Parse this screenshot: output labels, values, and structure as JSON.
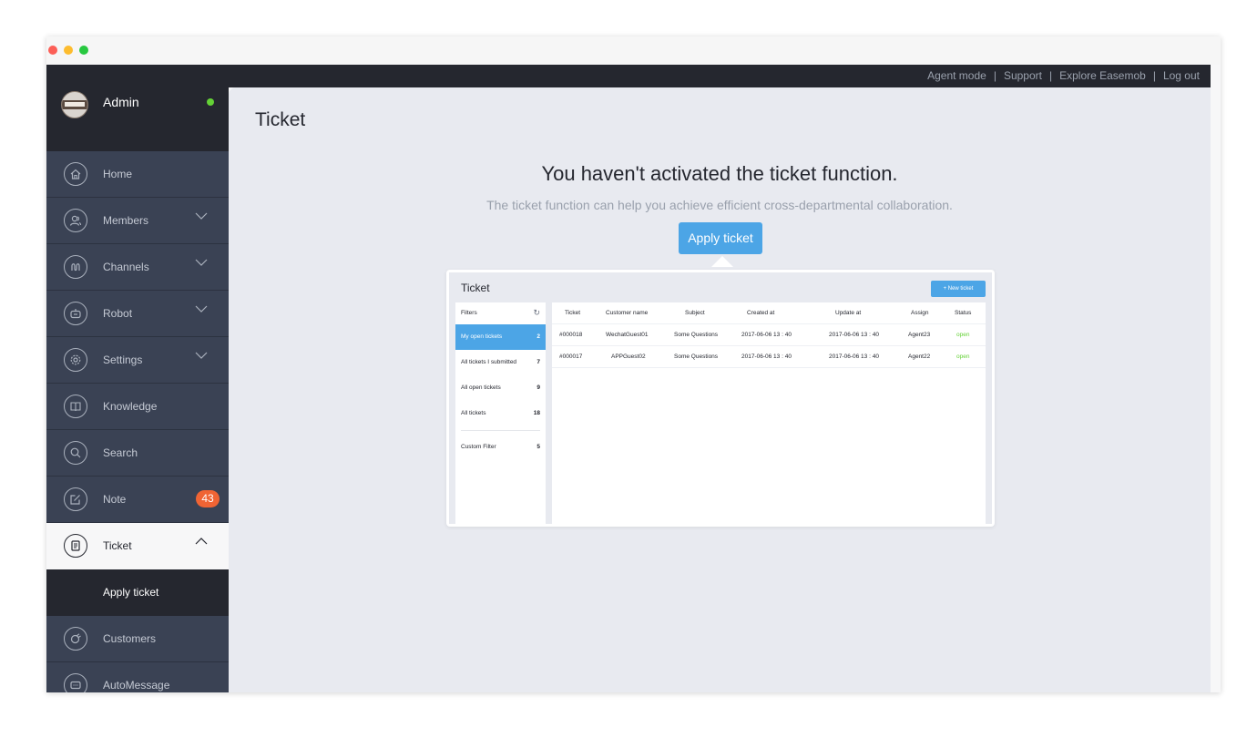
{
  "topbar": {
    "links": [
      "Agent mode",
      "Support",
      "Explore Easemob",
      "Log out"
    ],
    "separator": "|"
  },
  "profile": {
    "name": "Admin",
    "status_color": "#64d136"
  },
  "sidebar": {
    "items": [
      {
        "label": "Home",
        "icon": "home-icon"
      },
      {
        "label": "Members",
        "icon": "members-icon"
      },
      {
        "label": "Channels",
        "icon": "channels-icon"
      },
      {
        "label": "Robot",
        "icon": "robot-icon"
      },
      {
        "label": "Settings",
        "icon": "settings-icon"
      },
      {
        "label": "Knowledge",
        "icon": "knowledge-icon"
      },
      {
        "label": "Search",
        "icon": "search-icon"
      },
      {
        "label": "Note",
        "icon": "note-icon",
        "badge": "43"
      },
      {
        "label": "Ticket",
        "icon": "ticket-icon"
      },
      {
        "label": "Apply ticket"
      },
      {
        "label": "Customers",
        "icon": "customers-icon"
      },
      {
        "label": "AutoMessage",
        "icon": "automessage-icon"
      }
    ]
  },
  "main": {
    "title": "Ticket",
    "empty_title": "You haven't activated the ticket function.",
    "empty_subtitle": "The ticket function can help you achieve efficient cross-departmental collaboration.",
    "apply_button": "Apply ticket"
  },
  "preview": {
    "title": "Ticket",
    "new_ticket": "+ New ticket",
    "filters": {
      "header": "Filters",
      "items": [
        {
          "label": "My open tickets",
          "count": "2"
        },
        {
          "label": "All tickets I submitted",
          "count": "7"
        },
        {
          "label": "All open tickets",
          "count": "9"
        },
        {
          "label": "All tickets",
          "count": "18"
        },
        {
          "label": "Custom Filter",
          "count": "5"
        }
      ]
    },
    "columns": [
      "Ticket",
      "Customer name",
      "Subject",
      "Created at",
      "Update at",
      "Assign",
      "Status"
    ],
    "rows": [
      [
        "#000018",
        "WechatGuest01",
        "Some Questions",
        "2017-06-06 13 : 40",
        "2017-06-06 13 : 40",
        "Agent23",
        "open"
      ],
      [
        "#000017",
        "APPGuest02",
        "Some Questions",
        "2017-06-06 13 : 40",
        "2017-06-06 13 : 40",
        "Agent22",
        "open"
      ]
    ]
  },
  "colors": {
    "accent": "#4ca5e6",
    "badge": "#f06434",
    "sidebar": "#3a4254",
    "dark": "#25272f"
  }
}
